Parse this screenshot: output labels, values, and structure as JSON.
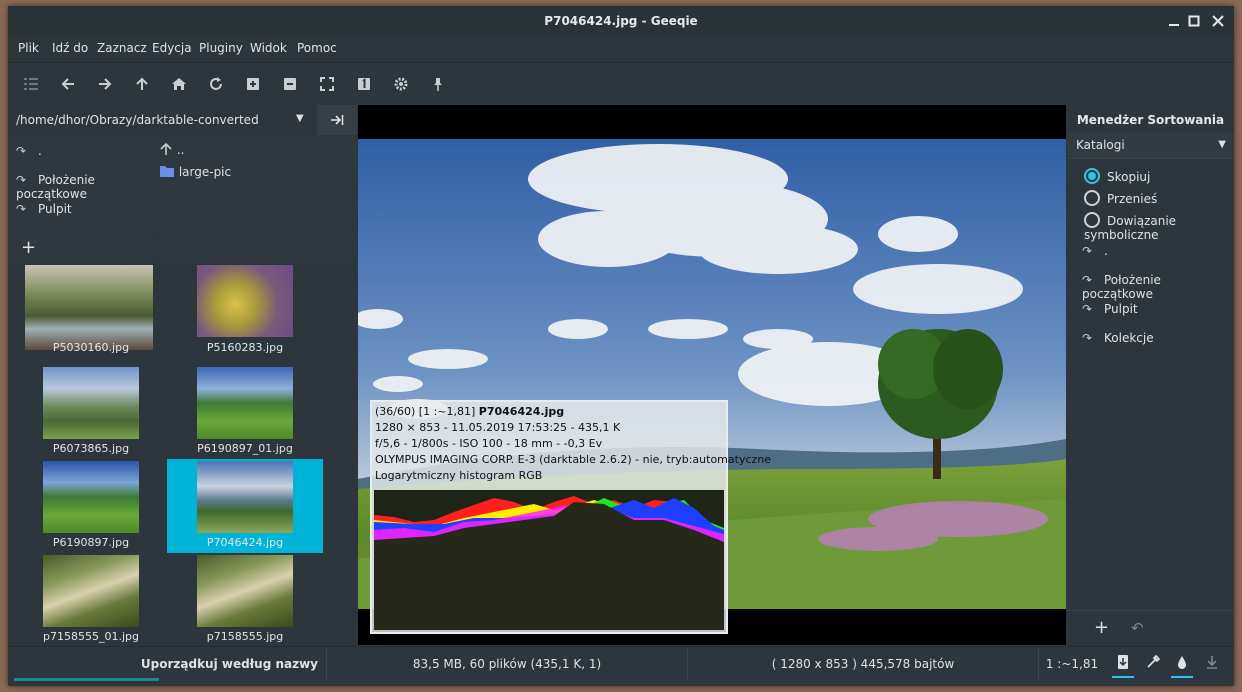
{
  "window": {
    "title": "P7046424.jpg - Geeqie"
  },
  "menu": [
    "Plik",
    "Idź do",
    "Zaznacz",
    "Edycja",
    "Pluginy",
    "Widok",
    "Pomoc"
  ],
  "toolbar": [
    "list-icon",
    "back-icon",
    "forward-icon",
    "up-icon",
    "home-icon",
    "refresh-icon",
    "zoom-in-icon",
    "zoom-out-icon",
    "fit-icon",
    "zoom-1-icon",
    "settings-icon",
    "pin-icon"
  ],
  "path": {
    "value": "/home/dhor/Obrazy/darktable-converted"
  },
  "bookmarks": [
    ".",
    "Położenie początkowe",
    "Pulpit"
  ],
  "dirs": [
    "..",
    "large-pic"
  ],
  "thumbs": [
    {
      "name": "P5030160.jpg"
    },
    {
      "name": "P5160283.jpg"
    },
    {
      "name": "P6073865.jpg"
    },
    {
      "name": "P6190897_01.jpg"
    },
    {
      "name": "P6190897.jpg"
    },
    {
      "name": "P7046424.jpg",
      "selected": true
    },
    {
      "name": "p7158555_01.jpg"
    },
    {
      "name": "p7158555.jpg"
    }
  ],
  "osd": {
    "line1_prefix": "(36/60) [1 :~1,81] ",
    "line1_name": "P7046424.jpg",
    "line2": "1280 × 853 - 11.05.2019 17:53:25 - 435,1 K",
    "line3": "f/5,6 - 1/800s - ISO 100 - 18 mm - -0,3 Ev",
    "line4": "OLYMPUS IMAGING CORP. E-3 (darktable 2.6.2) - nie, tryb:automatyczne",
    "line5": "Logarytmiczny histogram RGB"
  },
  "sort_manager": {
    "title": "Menedżer Sortowania",
    "combo": "Katalogi",
    "options": [
      "Skopiuj",
      "Przenieś",
      "Dowiązanie symboliczne"
    ],
    "selected_option": "Skopiuj",
    "bookmarks": [
      ".",
      "Położenie początkowe",
      "Pulpit",
      "Kolekcje"
    ]
  },
  "status": {
    "sort": "Uporządkuj według nazwy",
    "files": "83,5 MB, 60 plików (435,1 K, 1)",
    "dims": "( 1280 x 853 ) 445,578 bajtów",
    "zoom": "1 :~1,81"
  },
  "colors": {
    "selection": "#00b4d8",
    "accent": "#2ec6e6",
    "background": "#2c363c"
  }
}
